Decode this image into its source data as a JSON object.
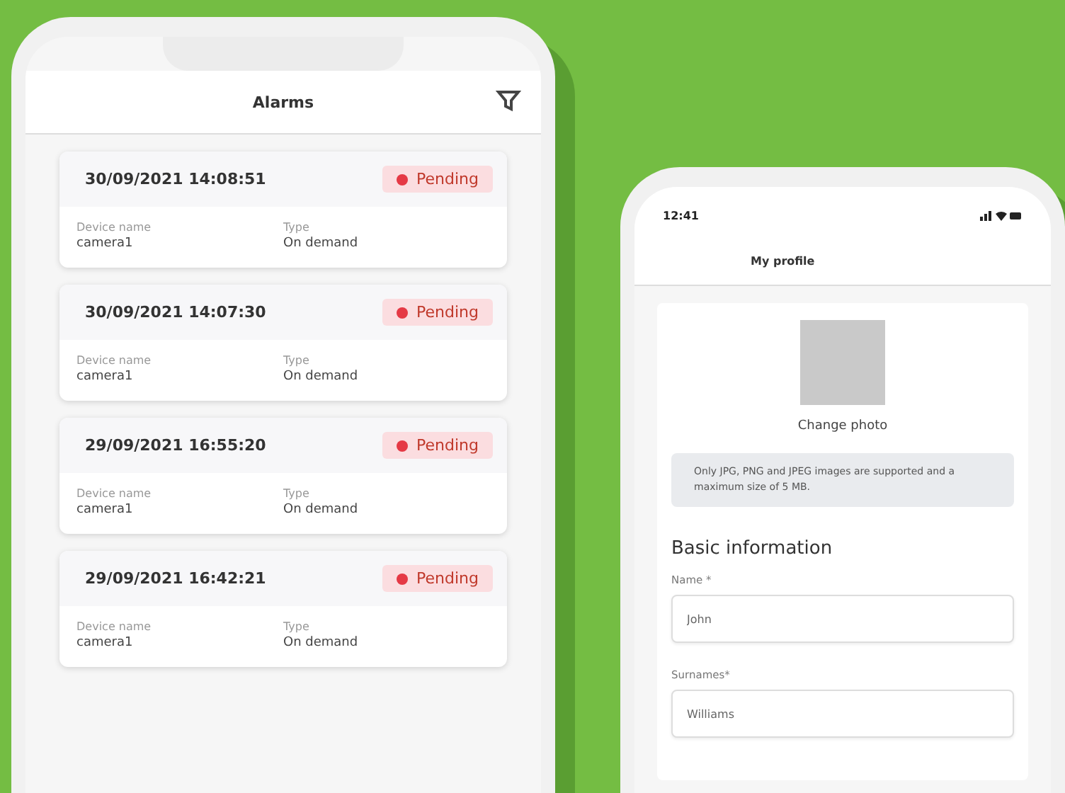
{
  "alarms_phone": {
    "title": "Alarms",
    "alarms": [
      {
        "datetime": "30/09/2021 14:08:51",
        "status": "Pending",
        "device_label": "Device name",
        "device": "camera1",
        "type_label": "Type",
        "type": "On demand"
      },
      {
        "datetime": "30/09/2021 14:07:30",
        "status": "Pending",
        "device_label": "Device name",
        "device": "camera1",
        "type_label": "Type",
        "type": "On demand"
      },
      {
        "datetime": "29/09/2021 16:55:20",
        "status": "Pending",
        "device_label": "Device name",
        "device": "camera1",
        "type_label": "Type",
        "type": "On demand"
      },
      {
        "datetime": "29/09/2021 16:42:21",
        "status": "Pending",
        "device_label": "Device name",
        "device": "camera1",
        "type_label": "Type",
        "type": "On demand"
      }
    ]
  },
  "profile_phone": {
    "time": "12:41",
    "title": "My profile",
    "change_photo": "Change photo",
    "notice": "Only JPG, PNG and JPEG images are supported and a maximum size of 5 MB.",
    "section_title": "Basic information",
    "fields": [
      {
        "label": "Name *",
        "value": "John"
      },
      {
        "label": "Surnames*",
        "value": "Williams"
      }
    ]
  }
}
